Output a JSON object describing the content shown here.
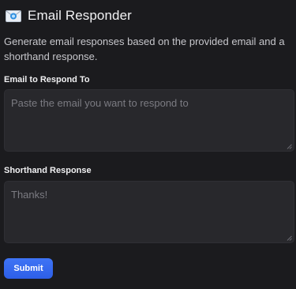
{
  "app": {
    "title": "Email Responder",
    "icon": "email-envelope-icon",
    "description": "Generate email responses based on the provided email and a shorthand response."
  },
  "form": {
    "email_field": {
      "label": "Email to Respond To",
      "placeholder": "Paste the email you want to respond to",
      "value": ""
    },
    "shorthand_field": {
      "label": "Shorthand Response",
      "placeholder": "Thanks!",
      "value": ""
    },
    "submit_label": "Submit"
  },
  "colors": {
    "background": "#1b1b1e",
    "field_background": "#28282c",
    "accent": "#2d5fe8"
  }
}
